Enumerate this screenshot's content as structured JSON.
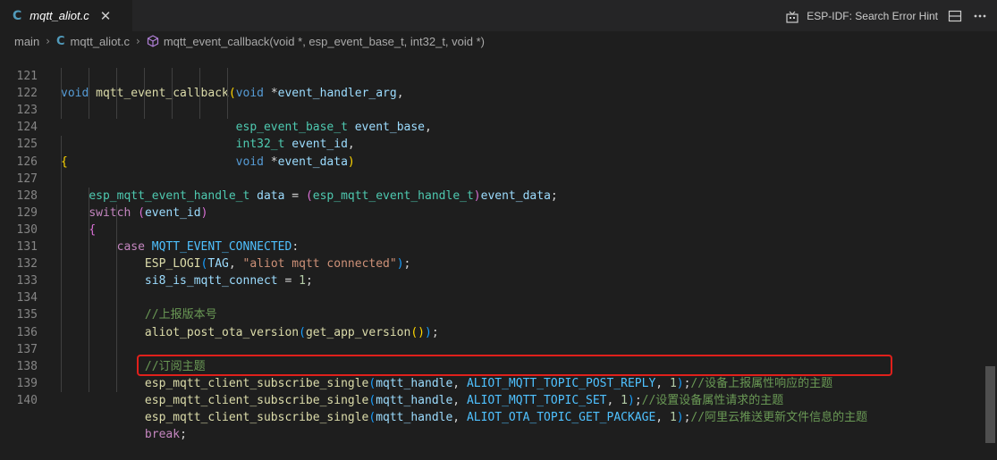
{
  "tab": {
    "icon": "c-language-icon",
    "filename": "mqtt_aliot.c",
    "close_glyph": "✕"
  },
  "toolbar": {
    "hint_label": "ESP-IDF: Search Error Hint"
  },
  "breadcrumb": {
    "items": [
      "main",
      "mqtt_aliot.c",
      "mqtt_event_callback(void *, esp_event_base_t, int32_t, void *)"
    ]
  },
  "code_lines": [
    {
      "no": "121"
    },
    {
      "no": "122"
    },
    {
      "no": "123"
    },
    {
      "no": "124"
    },
    {
      "no": "125"
    },
    {
      "no": "126"
    },
    {
      "no": "127"
    },
    {
      "no": "128"
    },
    {
      "no": "129"
    },
    {
      "no": "130"
    },
    {
      "no": "131"
    },
    {
      "no": "132"
    },
    {
      "no": "133"
    },
    {
      "no": "134"
    },
    {
      "no": "135"
    },
    {
      "no": "136"
    },
    {
      "no": "137"
    },
    {
      "no": "138"
    },
    {
      "no": "139"
    },
    {
      "no": "140"
    }
  ],
  "colors": {
    "highlight_box": "#e0201b",
    "editor_bg": "#1e1e1e"
  }
}
